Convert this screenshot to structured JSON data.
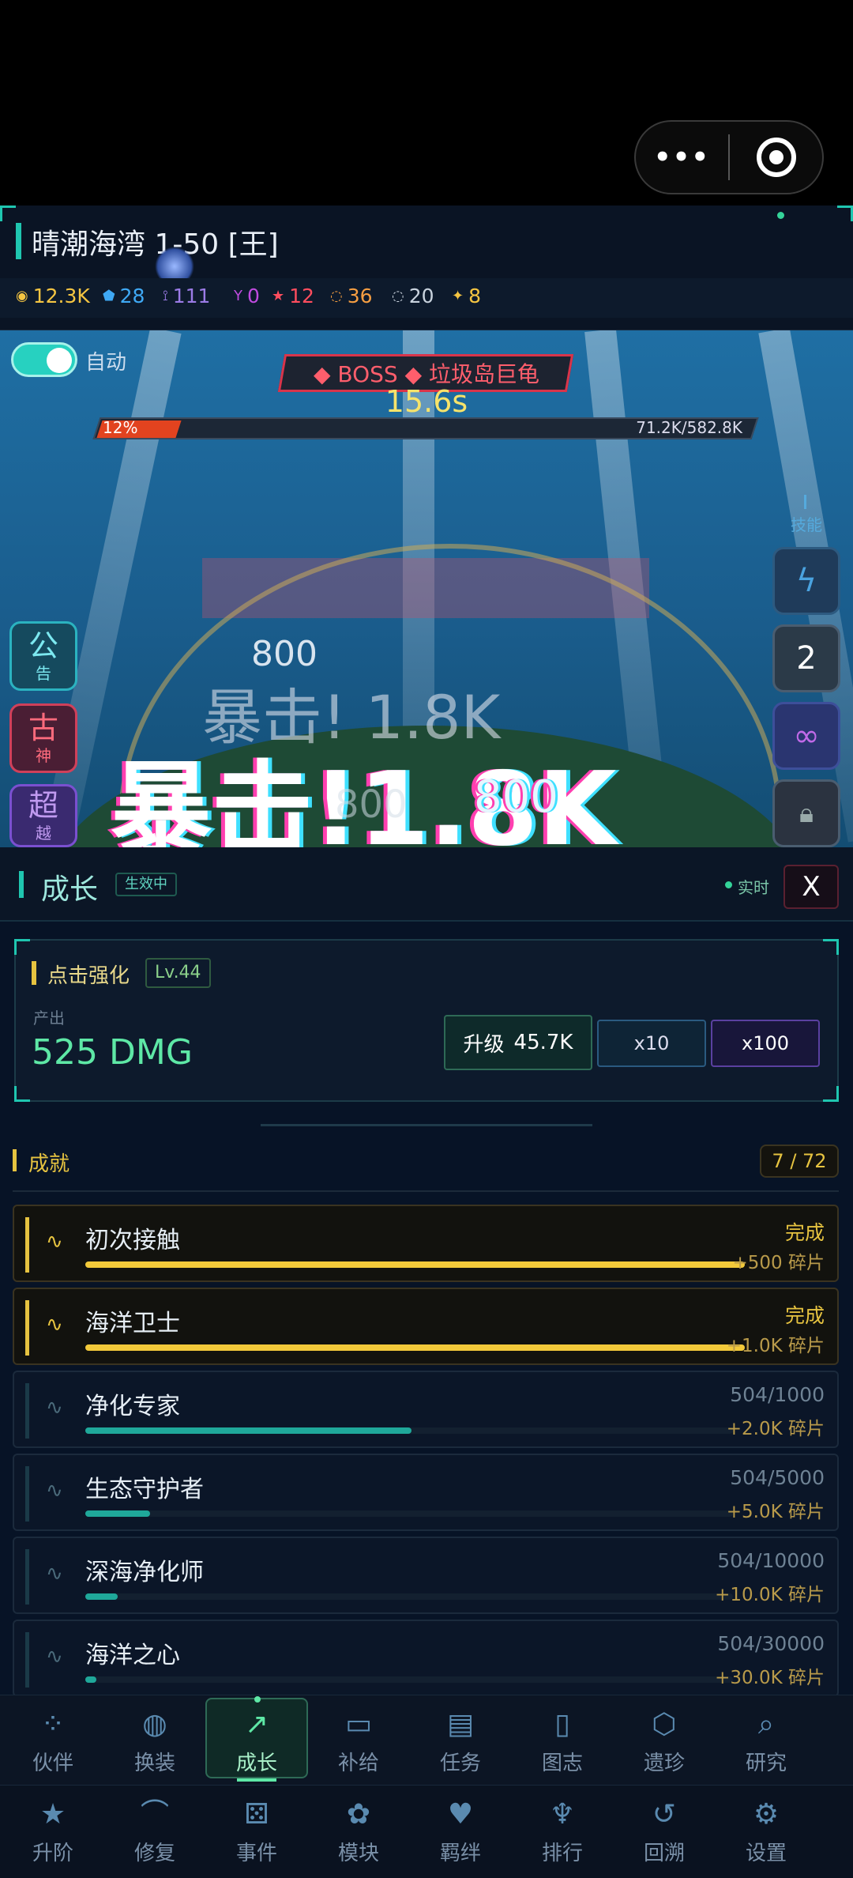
{
  "header": {
    "title": "晴潮海湾 1-50 [王]",
    "resources": [
      {
        "icon": "coin-icon",
        "value": "12.3K",
        "color": "#f5c542"
      },
      {
        "icon": "gem-icon",
        "value": "28",
        "color": "#3fa9f5"
      },
      {
        "icon": "sword-icon",
        "value": "111",
        "color": "#9b7be6"
      },
      {
        "icon": "fork-icon",
        "value": "0",
        "color": "#c04be0"
      },
      {
        "icon": "star-icon",
        "value": "12",
        "color": "#ff4d5e"
      },
      {
        "icon": "bulb-icon",
        "value": "36",
        "color": "#f59e42"
      },
      {
        "icon": "cycle-icon",
        "value": "20",
        "color": "#c9d3de"
      },
      {
        "icon": "spark-icon",
        "value": "8",
        "color": "#f5c542"
      }
    ]
  },
  "battle": {
    "auto_label": "自动",
    "boss_label": "◆ BOSS ◆ 垃圾岛巨龟",
    "timer": "15.6s",
    "hp_percent": "12%",
    "hp_fraction": 0.12,
    "hp_value": "71.2K/582.8K",
    "skills_label": "技能",
    "skill_count": "2",
    "side_buttons": [
      {
        "big": "公",
        "small": "告"
      },
      {
        "big": "古",
        "small": "神"
      },
      {
        "big": "超",
        "small": "越"
      }
    ],
    "damage_texts": [
      "800",
      "暴击! 1.8K",
      "暴击!1.8K",
      "800",
      "800"
    ]
  },
  "growth": {
    "title": "成长",
    "status_badge": "生效中",
    "live_label": "实时",
    "close_label": "X",
    "tap": {
      "title": "点击强化",
      "level": "Lv.44",
      "output_label": "产出",
      "output_value": "525 DMG",
      "upgrade_label": "升级",
      "upgrade_cost": "45.7K",
      "x10_label": "x10",
      "x100_label": "x100"
    }
  },
  "achievements": {
    "title": "成就",
    "count": "7 / 72",
    "items": [
      {
        "name": "初次接触",
        "status": "完成",
        "reward": "+500 碎片",
        "progress": 1.0,
        "done": true
      },
      {
        "name": "海洋卫士",
        "status": "完成",
        "reward": "+1.0K 碎片",
        "progress": 1.0,
        "done": true
      },
      {
        "name": "净化专家",
        "status": "504/1000",
        "reward": "+2.0K 碎片",
        "progress": 0.504,
        "done": false
      },
      {
        "name": "生态守护者",
        "status": "504/5000",
        "reward": "+5.0K 碎片",
        "progress": 0.1,
        "done": false
      },
      {
        "name": "深海净化师",
        "status": "504/10000",
        "reward": "+10.0K 碎片",
        "progress": 0.05,
        "done": false
      },
      {
        "name": "海洋之心",
        "status": "504/30000",
        "reward": "+30.0K 碎片",
        "progress": 0.017,
        "done": false
      }
    ]
  },
  "nav_primary": [
    {
      "label": "伙伴",
      "icon": "team-icon"
    },
    {
      "label": "换装",
      "icon": "palette-icon"
    },
    {
      "label": "成长",
      "icon": "trend-icon",
      "active": true
    },
    {
      "label": "补给",
      "icon": "card-icon"
    },
    {
      "label": "任务",
      "icon": "clipboard-icon"
    },
    {
      "label": "图志",
      "icon": "book-icon"
    },
    {
      "label": "遗珍",
      "icon": "gem-shield-icon"
    },
    {
      "label": "研究",
      "icon": "magnifier-icon"
    }
  ],
  "nav_secondary": [
    {
      "label": "升阶",
      "icon": "star-icon"
    },
    {
      "label": "修复",
      "icon": "repair-icon"
    },
    {
      "label": "事件",
      "icon": "dice-icon"
    },
    {
      "label": "模块",
      "icon": "module-icon"
    },
    {
      "label": "羁绊",
      "icon": "heart-icon"
    },
    {
      "label": "排行",
      "icon": "trophy-icon"
    },
    {
      "label": "回溯",
      "icon": "rewind-icon"
    },
    {
      "label": "设置",
      "icon": "gear-icon"
    }
  ]
}
